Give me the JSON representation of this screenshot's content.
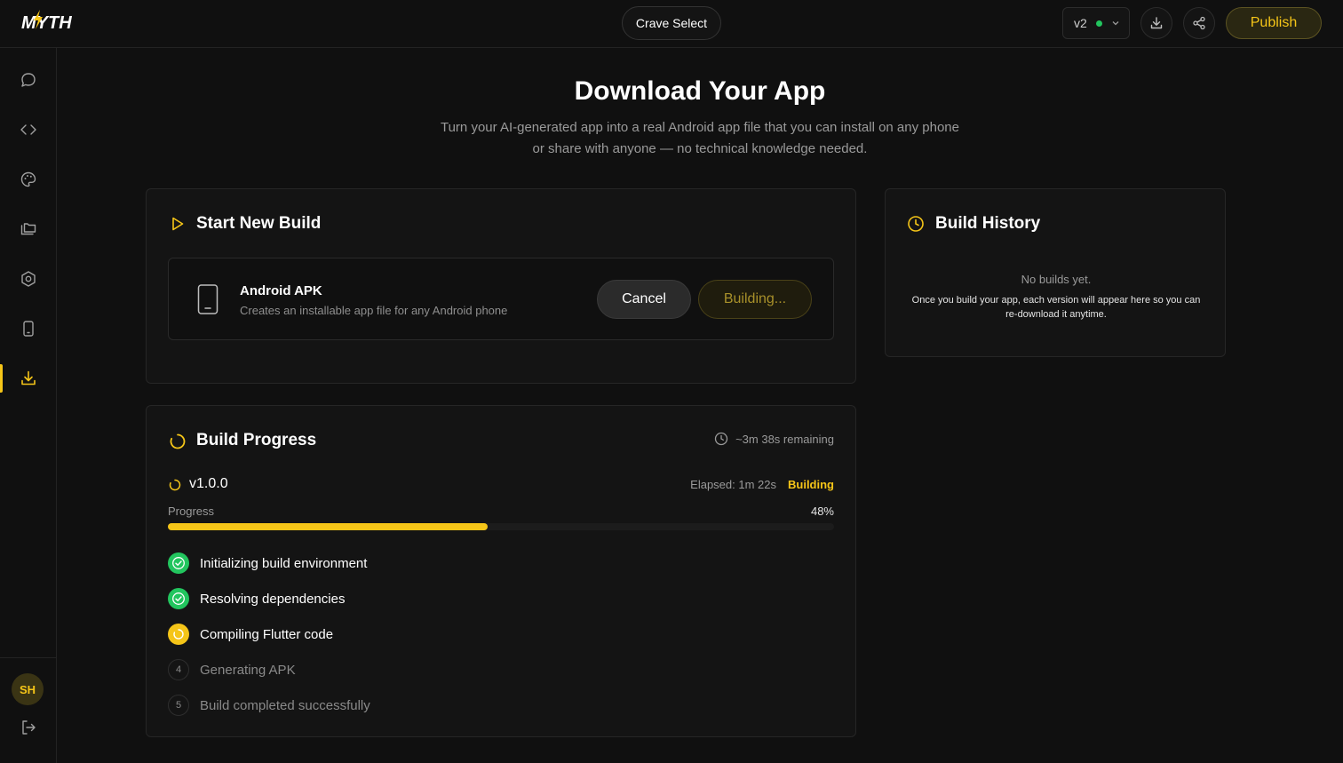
{
  "app": {
    "logo_text": "MYTH",
    "project_name": "Crave Select",
    "version": "v2",
    "publish_label": "Publish"
  },
  "sidebar": {
    "items": [
      "chat-icon",
      "code-icon",
      "palette-icon",
      "files-icon",
      "settings-icon",
      "device-icon",
      "download-icon"
    ],
    "active": "download-icon",
    "avatar_initials": "SH"
  },
  "page": {
    "title": "Download Your App",
    "subtitle": "Turn your AI-generated app into a real Android app file that you can install on any phone or share with anyone — no technical knowledge needed."
  },
  "new_build": {
    "title": "Start New Build",
    "apk_name": "Android APK",
    "apk_description": "Creates an installable app file for any Android phone",
    "cancel_label": "Cancel",
    "building_label": "Building..."
  },
  "history": {
    "title": "Build History",
    "empty_title": "No builds yet.",
    "empty_text": "Once you build your app, each version will appear here so you can re-download it anytime."
  },
  "progress": {
    "title": "Build Progress",
    "remaining": "~3m 38s remaining",
    "version": "v1.0.0",
    "elapsed": "Elapsed: 1m 22s",
    "status": "Building",
    "progress_label": "Progress",
    "percent_text": "48%",
    "percent_value": 0.48,
    "steps": [
      {
        "number": "1",
        "label": "Initializing build environment",
        "state": "done"
      },
      {
        "number": "2",
        "label": "Resolving dependencies",
        "state": "done"
      },
      {
        "number": "3",
        "label": "Compiling Flutter code",
        "state": "active"
      },
      {
        "number": "4",
        "label": "Generating APK",
        "state": "pending"
      },
      {
        "number": "5",
        "label": "Build completed successfully",
        "state": "pending"
      }
    ]
  },
  "colors": {
    "accent": "#f5c518",
    "success": "#22c55e",
    "background": "#101010",
    "card": "#141414"
  }
}
